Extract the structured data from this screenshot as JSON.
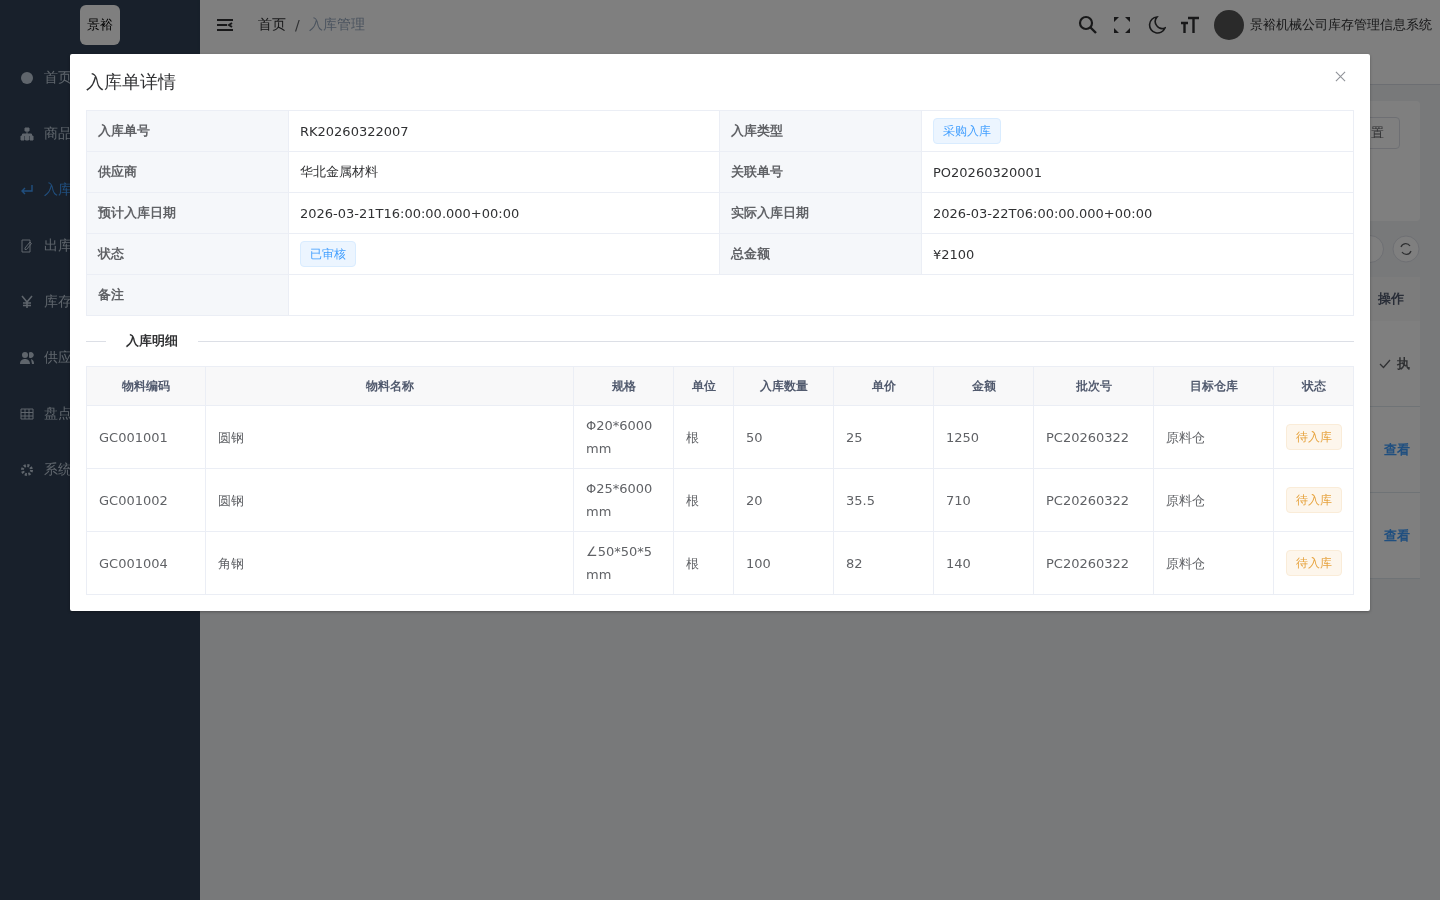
{
  "sidebar": {
    "logo": "景裕",
    "items": [
      {
        "label": "首页",
        "selected": false
      },
      {
        "label": "商品",
        "selected": false
      },
      {
        "label": "入库",
        "selected": true
      },
      {
        "label": "出库",
        "selected": false
      },
      {
        "label": "库存",
        "selected": false
      },
      {
        "label": "供应",
        "selected": false
      },
      {
        "label": "盘点",
        "selected": false
      },
      {
        "label": "系统",
        "selected": false
      }
    ]
  },
  "header": {
    "breadcrumb": [
      "首页",
      "入库管理"
    ],
    "breadcrumb_separator": "/",
    "user": "景裕机械公司库存管理信息系统"
  },
  "background": {
    "reset_button": "置",
    "column_header": "操作",
    "execute_link": "执",
    "view_links": [
      "查看",
      "查看"
    ]
  },
  "dialog": {
    "title": "入库单详情",
    "fields": [
      [
        {
          "label": "入库单号",
          "value": "RK20260322007"
        },
        {
          "label": "入库类型",
          "value": "采购入库",
          "kind": "primary"
        }
      ],
      [
        {
          "label": "供应商",
          "value": "华北金属材料"
        },
        {
          "label": "关联单号",
          "value": "PO20260320001"
        }
      ],
      [
        {
          "label": "预计入库日期",
          "value": "2026-03-21T16:00:00.000+00:00"
        },
        {
          "label": "实际入库日期",
          "value": "2026-03-22T06:00:00.000+00:00"
        }
      ],
      [
        {
          "label": "状态",
          "value": "已审核",
          "kind": "primary"
        },
        {
          "label": "总金额",
          "value": "¥2100"
        }
      ],
      [
        {
          "label": "备注"
        }
      ]
    ],
    "section_title": "入库明细",
    "table": {
      "columns": [
        "物料编码",
        "物料名称",
        "规格",
        "单位",
        "入库数量",
        "单价",
        "金额",
        "批次号",
        "目标仓库",
        "状态"
      ],
      "rows": [
        {
          "cells": [
            "GC001001",
            "圆钢",
            "Φ20*6000mm",
            "根",
            "50",
            "25",
            "1250",
            "PC20260322",
            "原料仓"
          ],
          "status": "待入库",
          "kind": "warning"
        },
        {
          "cells": [
            "GC001002",
            "圆钢",
            "Φ25*6000mm",
            "根",
            "20",
            "35.5",
            "710",
            "PC20260322",
            "原料仓"
          ],
          "status": "待入库",
          "kind": "warning"
        },
        {
          "cells": [
            "GC001004",
            "角钢",
            "∠50*50*5mm",
            "根",
            "100",
            "82",
            "140",
            "PC20260322",
            "原料仓"
          ],
          "status": "待入库",
          "kind": "warning"
        }
      ]
    }
  }
}
